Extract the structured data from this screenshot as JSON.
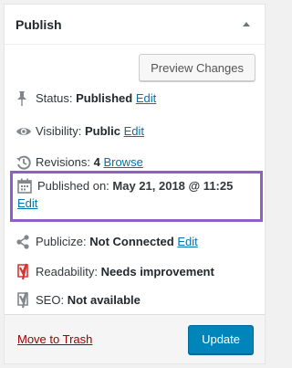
{
  "panel": {
    "title": "Publish",
    "preview_button": "Preview Changes",
    "status": {
      "label": "Status:",
      "value": "Published",
      "edit": "Edit",
      "icon": "pin-icon"
    },
    "visibility": {
      "label": "Visibility:",
      "value": "Public",
      "edit": "Edit",
      "icon": "eye-icon"
    },
    "revisions": {
      "label": "Revisions:",
      "value": "4",
      "browse": "Browse",
      "icon": "history-icon"
    },
    "published_on": {
      "label": "Published on:",
      "value": "May 21, 2018 @ 11:25",
      "edit": "Edit",
      "icon": "calendar-icon"
    },
    "publicize": {
      "label": "Publicize:",
      "value": "Not Connected",
      "edit": "Edit",
      "icon": "share-icon"
    },
    "readability": {
      "label": "Readability:",
      "value": "Needs improvement",
      "icon": "yoast-red-icon",
      "color": "#dc3232"
    },
    "seo": {
      "label": "SEO:",
      "value": "Not available",
      "icon": "yoast-gray-icon"
    },
    "footer": {
      "trash": "Move to Trash",
      "update": "Update"
    }
  },
  "colors": {
    "link": "#0073aa",
    "trash": "#a00000",
    "update_bg": "#0085ba",
    "highlight": "#8c61c2"
  }
}
